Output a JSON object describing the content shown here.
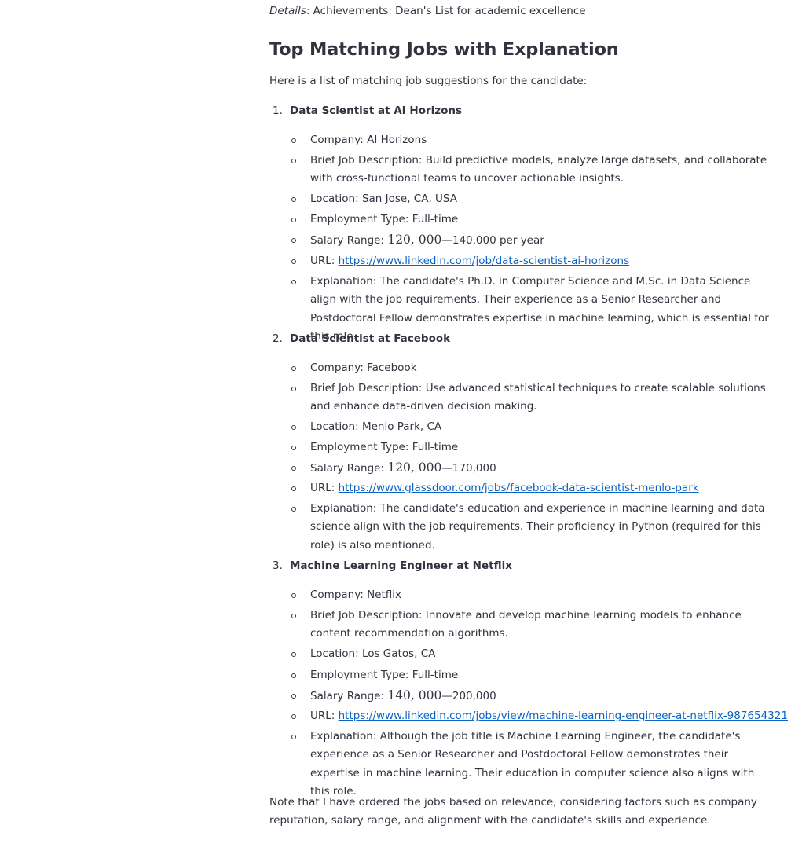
{
  "details": {
    "label": "Details",
    "text": ": Achievements: Dean's List for academic excellence"
  },
  "section_title": "Top Matching Jobs with Explanation",
  "intro": "Here is a list of matching job suggestions for the candidate:",
  "jobs": [
    {
      "number": "1.",
      "title": "Data Scientist at AI Horizons",
      "company": "Company: AI Horizons",
      "description": "Brief Job Description: Build predictive models, analyze large datasets, and collaborate with cross-functional teams to uncover actionable insights.",
      "location": "Location: San Jose, CA, USA",
      "employment": "Employment Type: Full-time",
      "salary_prefix": "Salary Range: ",
      "salary_math": "120, 000",
      "salary_dash": "—",
      "salary_rest": "140,000 per year",
      "url_prefix": "URL: ",
      "url": "https://www.linkedin.com/job/data-scientist-ai-horizons",
      "explanation": "Explanation: The candidate's Ph.D. in Computer Science and M.Sc. in Data Science align with the job requirements. Their experience as a Senior Researcher and Postdoctoral Fellow demonstrates expertise in machine learning, which is essential for this role."
    },
    {
      "number": "2.",
      "title": "Data Scientist at Facebook",
      "company": "Company: Facebook",
      "description": "Brief Job Description: Use advanced statistical techniques to create scalable solutions and enhance data-driven decision making.",
      "location": "Location: Menlo Park, CA",
      "employment": "Employment Type: Full-time",
      "salary_prefix": "Salary Range: ",
      "salary_math": "120, 000",
      "salary_dash": "—",
      "salary_rest": "170,000",
      "url_prefix": "URL: ",
      "url": "https://www.glassdoor.com/jobs/facebook-data-scientist-menlo-park",
      "explanation": "Explanation: The candidate's education and experience in machine learning and data science align with the job requirements. Their proficiency in Python (required for this role) is also mentioned."
    },
    {
      "number": "3.",
      "title": "Machine Learning Engineer at Netflix",
      "company": "Company: Netflix",
      "description": "Brief Job Description: Innovate and develop machine learning models to enhance content recommendation algorithms.",
      "location": "Location: Los Gatos, CA",
      "employment": "Employment Type: Full-time",
      "salary_prefix": "Salary Range: ",
      "salary_math": "140, 000",
      "salary_dash": "—",
      "salary_rest": "200,000",
      "url_prefix": "URL: ",
      "url": "https://www.linkedin.com/jobs/view/machine-learning-engineer-at-netflix-987654321",
      "explanation": "Explanation: Although the job title is Machine Learning Engineer, the candidate's experience as a Senior Researcher and Postdoctoral Fellow demonstrates their expertise in machine learning. Their education in computer science also aligns with this role."
    }
  ],
  "note": "Note that I have ordered the jobs based on relevance, considering factors such as company reputation, salary range, and alignment with the candidate's skills and experience."
}
